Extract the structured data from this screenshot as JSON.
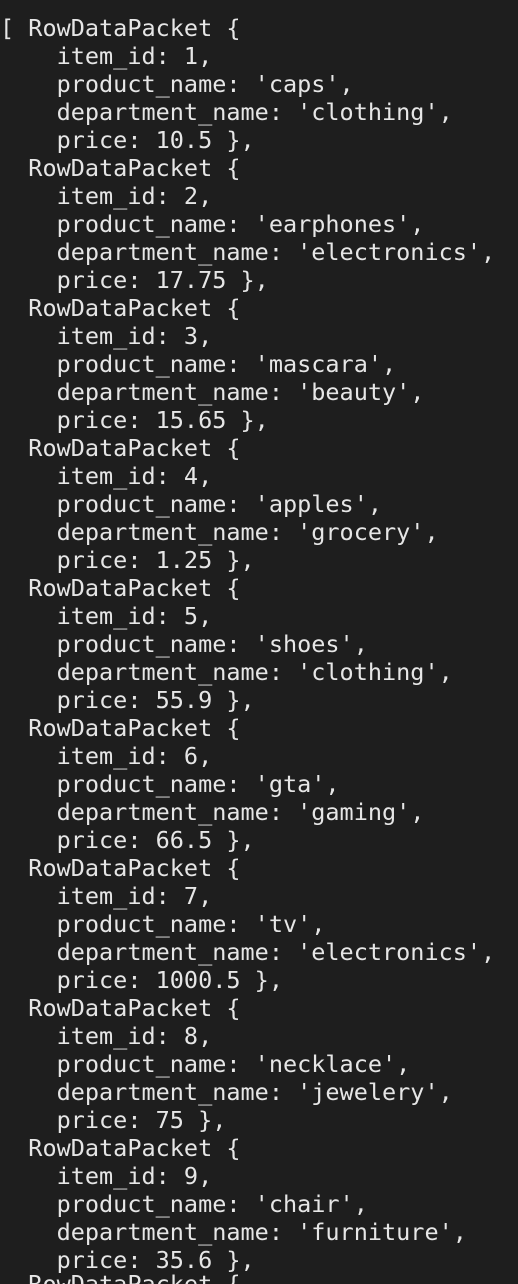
{
  "terminal": {
    "lines": [
      "[ RowDataPacket {",
      "    item_id: 1,",
      "    product_name: 'caps',",
      "    department_name: 'clothing',",
      "    price: 10.5 },",
      "  RowDataPacket {",
      "    item_id: 2,",
      "    product_name: 'earphones',",
      "    department_name: 'electronics',",
      "    price: 17.75 },",
      "  RowDataPacket {",
      "    item_id: 3,",
      "    product_name: 'mascara',",
      "    department_name: 'beauty',",
      "    price: 15.65 },",
      "  RowDataPacket {",
      "    item_id: 4,",
      "    product_name: 'apples',",
      "    department_name: 'grocery',",
      "    price: 1.25 },",
      "  RowDataPacket {",
      "    item_id: 5,",
      "    product_name: 'shoes',",
      "    department_name: 'clothing',",
      "    price: 55.9 },",
      "  RowDataPacket {",
      "    item_id: 6,",
      "    product_name: 'gta',",
      "    department_name: 'gaming',",
      "    price: 66.5 },",
      "  RowDataPacket {",
      "    item_id: 7,",
      "    product_name: 'tv',",
      "    department_name: 'electronics',",
      "    price: 1000.5 },",
      "  RowDataPacket {",
      "    item_id: 8,",
      "    product_name: 'necklace',",
      "    department_name: 'jewelery',",
      "    price: 75 },",
      "  RowDataPacket {",
      "    item_id: 9,",
      "    product_name: 'chair',",
      "    department_name: 'furniture',",
      "    price: 35.6 },",
      "  RowDataPacket {"
    ]
  }
}
